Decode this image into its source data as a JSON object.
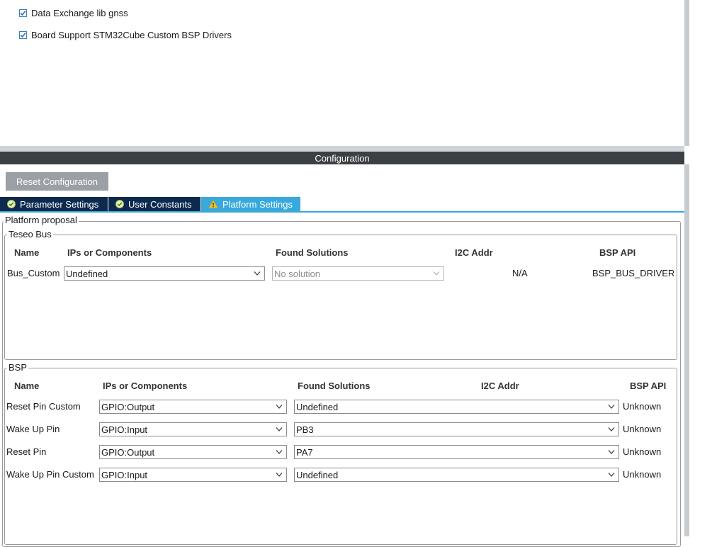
{
  "components": [
    {
      "label": "Data Exchange lib gnss",
      "checked": true
    },
    {
      "label": "Board Support STM32Cube Custom BSP Drivers",
      "checked": true
    }
  ],
  "config_bar": {
    "title": "Configuration"
  },
  "reset_button": {
    "label": "Reset Configuration"
  },
  "tabs": [
    {
      "label": "Parameter Settings",
      "status": "ok",
      "active": false
    },
    {
      "label": "User Constants",
      "status": "ok",
      "active": false
    },
    {
      "label": "Platform Settings",
      "status": "warning",
      "active": true
    }
  ],
  "platform": {
    "legend": "Platform proposal",
    "teseo_bus": {
      "legend": "Teseo Bus",
      "headers": {
        "name": "Name",
        "ips": "IPs or Components",
        "found": "Found Solutions",
        "i2c": "I2C Addr",
        "api": "BSP API"
      },
      "rows": [
        {
          "name": "Bus_Custom",
          "ips": "Undefined",
          "found": "No solution",
          "i2c": "N/A",
          "api": "BSP_BUS_DRIVER"
        }
      ]
    },
    "bsp": {
      "legend": "BSP",
      "headers": {
        "name": "Name",
        "ips": "IPs or Components",
        "found": "Found Solutions",
        "i2c": "I2C Addr",
        "api": "BSP API"
      },
      "rows": [
        {
          "name": "Reset Pin Custom",
          "ips": "GPIO:Output",
          "found": "Undefined",
          "api": "Unknown"
        },
        {
          "name": "Wake Up Pin",
          "ips": "GPIO:Input",
          "found": "PB3",
          "api": "Unknown"
        },
        {
          "name": "Reset Pin",
          "ips": "GPIO:Output",
          "found": "PA7",
          "api": "Unknown"
        },
        {
          "name": "Wake Up Pin Custom",
          "ips": "GPIO:Input",
          "found": "Undefined",
          "api": "Unknown"
        }
      ]
    }
  },
  "colors": {
    "accent": "#39a9dc",
    "tab_dark": "#0b2a4e",
    "config_bar": "#3d4043",
    "warning": "#f2c12e",
    "ok": "#8bc34a"
  }
}
